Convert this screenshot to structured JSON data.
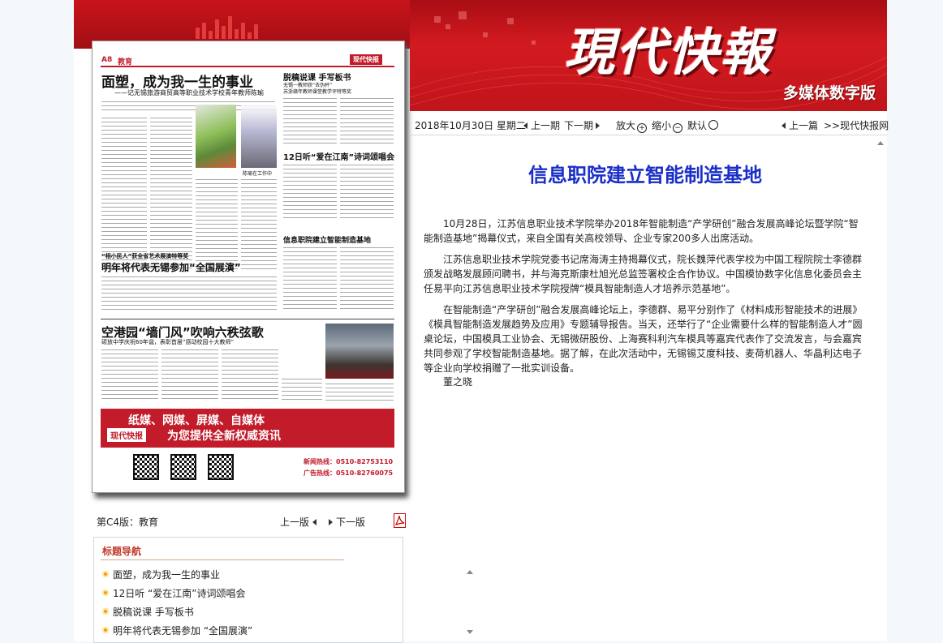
{
  "header": {
    "logo": "現代快報",
    "subtitle": "多媒体数字版"
  },
  "toolbar": {
    "date": "2018年10月30日 星期二",
    "prev_day": "上一期",
    "next_day": "下一期",
    "zoom_in": "放大",
    "zoom_out": "缩小",
    "default": "默认",
    "prev_article": "上一篇",
    "home_link": ">>现代快报网"
  },
  "article": {
    "title": "信息职院建立智能制造基地",
    "paragraphs": [
      "10月28日，江苏信息职业技术学院举办2018年智能制造“产学研创”融合发展高峰论坛暨学院“智能制造基地”揭幕仪式，来自全国有关高校领导、企业专家200多人出席活动。",
      "江苏信息职业技术学院党委书记席海涛主持揭幕仪式，院长魏萍代表学校为中国工程院院士李德群颁发战略发展顾问聘书，并与海克斯康杜旭光总监签署校企合作协议。中国模协数字化信息化委员会主任易平向江苏信息职业技术学院授牌“模具智能制造人才培养示范基地”。",
      "在智能制造“产学研创”融合发展高峰论坛上，李德群、易平分别作了《材料成形智能技术的进展》《模具智能制造发展趋势及应用》专题辅导报告。当天，还举行了“企业需要什么样的智能制造人才”圆桌论坛，中国模具工业协会、无锡微研股份、上海赛科利汽车模具等嘉宾代表作了交流发言，与会嘉宾共同参观了学校智能制造基地。据了解，在此次活动中，无锡锡艾度科技、麦荷机器人、华晶利达电子等企业向学校捐赠了一批实训设备。",
      "董之晓"
    ]
  },
  "newspaper": {
    "page_tag": "A8",
    "section": "教育",
    "masthead": "现代快报",
    "headline1": "面塑，成为我一生的事业",
    "subhead1": "——记无锡旅游商贸高等职业技术学校青年教师陈瑜",
    "headline2": "脱稿说课  手写板书",
    "subhead2a": "无锡一教师获“去伪杯”",
    "subhead2b": "苏浙赣年教师课堂教学评特等奖",
    "headline3": "12日听“爱在江南”诗词颂唱会",
    "headline4": "信息职院建立智能制造基地",
    "headline5a": "“相小民人”获全省艺术展演特等奖",
    "headline5": "明年将代表无锡参加“全国展演”",
    "headline6": "空港园“墙门风”吹响六秩弦歌",
    "subhead6": "硕放中学庆祝60年诞，表彰首届“感动校园十大教师”",
    "photo_caption": "陈瑜在工作中",
    "ad_line1": "纸媒、网媒、屏媒、自媒体",
    "ad_line2": "为您提供全新权威资讯",
    "ad_hotline1": "新闻热线：0510-82753110",
    "ad_hotline2": "广告热线：0510-82760075"
  },
  "page_info": {
    "edition": "第C4版：教育",
    "prev_page": "上一版",
    "next_page": "下一版"
  },
  "nav": {
    "title": "标题导航",
    "items": [
      "面塑，成为我一生的事业",
      "12日听 “爱在江南”诗词颂唱会",
      "脱稿说课 手写板书",
      "明年将代表无锡参加 “全国展演”"
    ]
  },
  "colors": {
    "brand_red": "#c8141a",
    "title_blue": "#1a2ec8",
    "bullet": "#f2a000"
  }
}
